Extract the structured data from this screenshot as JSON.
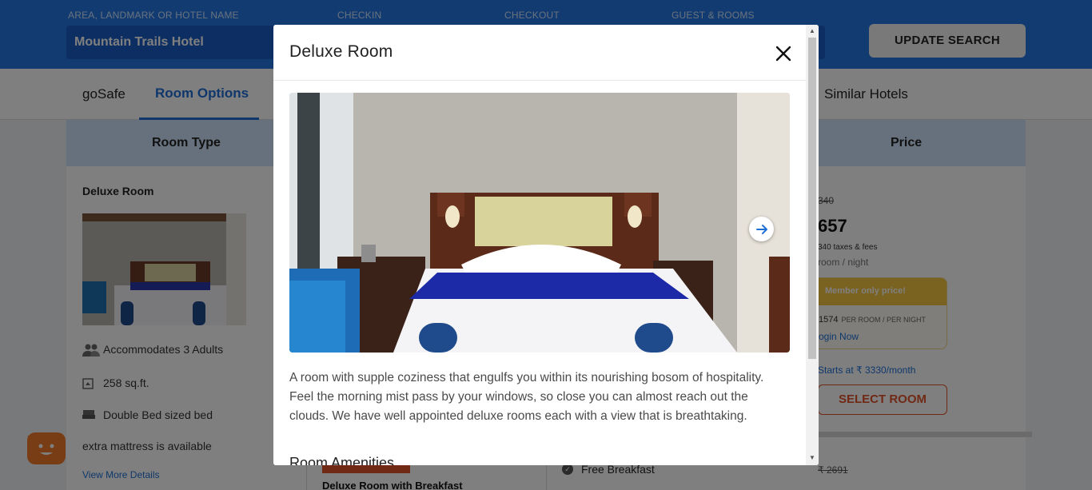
{
  "search": {
    "labels": {
      "location": "AREA, LANDMARK OR HOTEL NAME",
      "checkin": "CHECKIN",
      "checkout": "CHECKOUT",
      "guests": "GUEST & ROOMS"
    },
    "location_value": "Mountain Trails Hotel",
    "update_button": "UPDATE SEARCH"
  },
  "tabs": [
    {
      "label": "goSafe",
      "active": false
    },
    {
      "label": "Room Options",
      "active": true
    },
    {
      "label": "Similar Hotels",
      "active": false
    }
  ],
  "table": {
    "headers": {
      "room_type": "Room Type",
      "price": "Price"
    }
  },
  "room": {
    "name": "Deluxe Room",
    "features": [
      {
        "icon": "people-icon",
        "text": "Accommodates 3 Adults"
      },
      {
        "icon": "area-icon",
        "text": "258 sq.ft."
      },
      {
        "icon": "bed-icon",
        "text": "Double Bed sized bed"
      },
      {
        "icon": "",
        "text": "extra mattress is available"
      }
    ],
    "view_more": "View More Details"
  },
  "price": {
    "original_partial": "340",
    "current_partial": "657",
    "taxes_partial": "340 taxes & fees",
    "per_night_partial": "room / night",
    "member_title": "Member only price!",
    "member_rate_partial": "1574",
    "member_rate_unit": "PER ROOM / PER NIGHT",
    "login_partial": "ogin Now",
    "emi_partial": "Starts at ₹ 3330/month",
    "select_button": "SELECT ROOM",
    "second_original": "₹ 2691"
  },
  "plan": {
    "name": "Deluxe Room with Breakfast",
    "inclusion": "Free Breakfast"
  },
  "modal": {
    "title": "Deluxe Room",
    "description": "A room with supple coziness that engulfs you within its nourishing bosom of hospitality. Feel the morning mist pass by your windows, so close you can almost reach out the clouds. We have well appointed deluxe rooms each with a view that is breathtaking.",
    "amenities_title": "Room Amenities"
  },
  "colors": {
    "brand_blue": "#2276e3",
    "accent_orange": "#e0532b",
    "member_gold": "#f5c542"
  }
}
